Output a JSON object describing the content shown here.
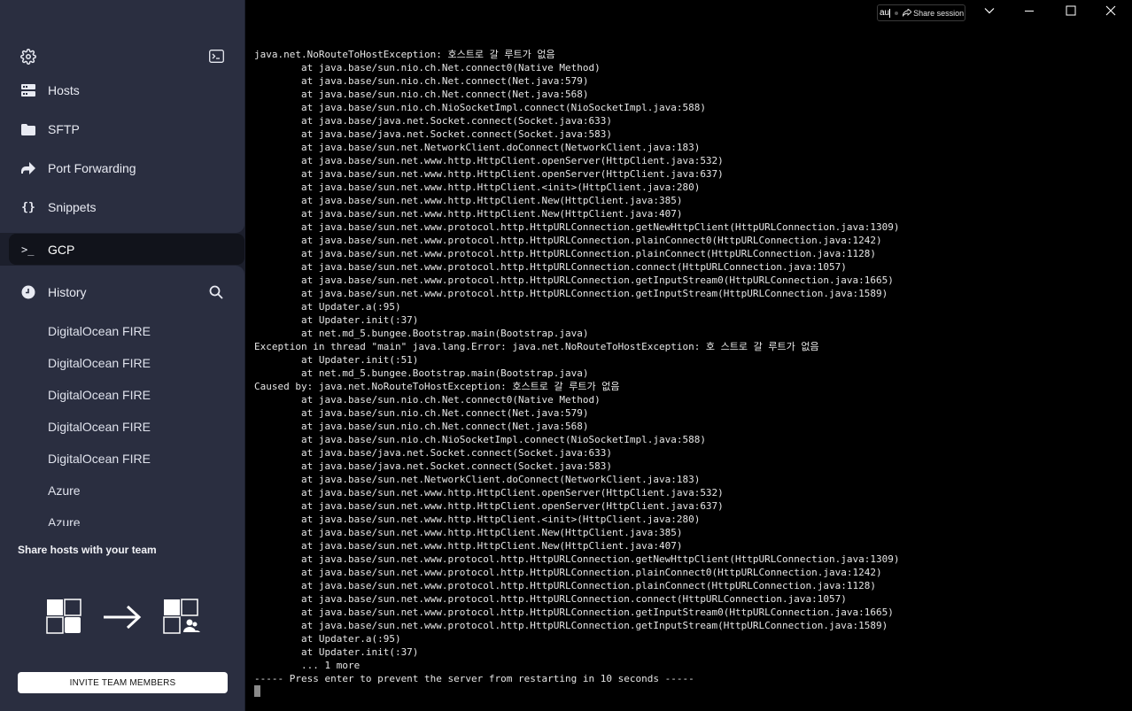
{
  "sidebar": {
    "nav": [
      {
        "label": "Hosts",
        "icon": "hosts-icon"
      },
      {
        "label": "SFTP",
        "icon": "folder-icon"
      },
      {
        "label": "Port Forwarding",
        "icon": "port-forward-icon"
      },
      {
        "label": "Snippets",
        "icon": "braces-icon"
      }
    ],
    "active": {
      "label": "GCP",
      "icon": "terminal-prompt-icon"
    },
    "history": {
      "label": "History",
      "items": [
        "DigitalOcean FIRE",
        "DigitalOcean FIRE",
        "DigitalOcean FIRE",
        "DigitalOcean FIRE",
        "DigitalOcean FIRE",
        "Azure",
        "Azure"
      ]
    },
    "share": {
      "title": "Share hosts with your team",
      "button": "INVITE TEAM MEMBERS"
    }
  },
  "titlebar": {
    "search_value": "au",
    "share_session": "Share session"
  },
  "terminal": {
    "lines": [
      "java.net.NoRouteToHostException: 호스트로 갈 루트가 없음",
      "        at java.base/sun.nio.ch.Net.connect0(Native Method)",
      "        at java.base/sun.nio.ch.Net.connect(Net.java:579)",
      "        at java.base/sun.nio.ch.Net.connect(Net.java:568)",
      "        at java.base/sun.nio.ch.NioSocketImpl.connect(NioSocketImpl.java:588)",
      "        at java.base/java.net.Socket.connect(Socket.java:633)",
      "        at java.base/java.net.Socket.connect(Socket.java:583)",
      "        at java.base/sun.net.NetworkClient.doConnect(NetworkClient.java:183)",
      "        at java.base/sun.net.www.http.HttpClient.openServer(HttpClient.java:532)",
      "        at java.base/sun.net.www.http.HttpClient.openServer(HttpClient.java:637)",
      "        at java.base/sun.net.www.http.HttpClient.<init>(HttpClient.java:280)",
      "        at java.base/sun.net.www.http.HttpClient.New(HttpClient.java:385)",
      "        at java.base/sun.net.www.http.HttpClient.New(HttpClient.java:407)",
      "        at java.base/sun.net.www.protocol.http.HttpURLConnection.getNewHttpClient(HttpURLConnection.java:1309)",
      "        at java.base/sun.net.www.protocol.http.HttpURLConnection.plainConnect0(HttpURLConnection.java:1242)",
      "        at java.base/sun.net.www.protocol.http.HttpURLConnection.plainConnect(HttpURLConnection.java:1128)",
      "        at java.base/sun.net.www.protocol.http.HttpURLConnection.connect(HttpURLConnection.java:1057)",
      "        at java.base/sun.net.www.protocol.http.HttpURLConnection.getInputStream0(HttpURLConnection.java:1665)",
      "        at java.base/sun.net.www.protocol.http.HttpURLConnection.getInputStream(HttpURLConnection.java:1589)",
      "        at Updater.a(:95)",
      "        at Updater.init(:37)",
      "        at net.md_5.bungee.Bootstrap.main(Bootstrap.java)",
      "Exception in thread \"main\" java.lang.Error: java.net.NoRouteToHostException: 호 스트로 갈 루트가 없음",
      "        at Updater.init(:51)",
      "        at net.md_5.bungee.Bootstrap.main(Bootstrap.java)",
      "Caused by: java.net.NoRouteToHostException: 호스트로 갈 루트가 없음",
      "        at java.base/sun.nio.ch.Net.connect0(Native Method)",
      "        at java.base/sun.nio.ch.Net.connect(Net.java:579)",
      "        at java.base/sun.nio.ch.Net.connect(Net.java:568)",
      "        at java.base/sun.nio.ch.NioSocketImpl.connect(NioSocketImpl.java:588)",
      "        at java.base/java.net.Socket.connect(Socket.java:633)",
      "        at java.base/java.net.Socket.connect(Socket.java:583)",
      "        at java.base/sun.net.NetworkClient.doConnect(NetworkClient.java:183)",
      "        at java.base/sun.net.www.http.HttpClient.openServer(HttpClient.java:532)",
      "        at java.base/sun.net.www.http.HttpClient.openServer(HttpClient.java:637)",
      "        at java.base/sun.net.www.http.HttpClient.<init>(HttpClient.java:280)",
      "        at java.base/sun.net.www.http.HttpClient.New(HttpClient.java:385)",
      "        at java.base/sun.net.www.http.HttpClient.New(HttpClient.java:407)",
      "        at java.base/sun.net.www.protocol.http.HttpURLConnection.getNewHttpClient(HttpURLConnection.java:1309)",
      "        at java.base/sun.net.www.protocol.http.HttpURLConnection.plainConnect0(HttpURLConnection.java:1242)",
      "        at java.base/sun.net.www.protocol.http.HttpURLConnection.plainConnect(HttpURLConnection.java:1128)",
      "        at java.base/sun.net.www.protocol.http.HttpURLConnection.connect(HttpURLConnection.java:1057)",
      "        at java.base/sun.net.www.protocol.http.HttpURLConnection.getInputStream0(HttpURLConnection.java:1665)",
      "        at java.base/sun.net.www.protocol.http.HttpURLConnection.getInputStream(HttpURLConnection.java:1589)",
      "        at Updater.a(:95)",
      "        at Updater.init(:37)",
      "        ... 1 more",
      "----- Press enter to prevent the server from restarting in 10 seconds -----"
    ]
  },
  "colors": {
    "sidebar_bg": "#2a2e40",
    "app_bg": "#1c1f2c",
    "active_item_bg": "#11131b",
    "terminal_bg": "#000000",
    "terminal_fg": "#e6e6e6"
  }
}
